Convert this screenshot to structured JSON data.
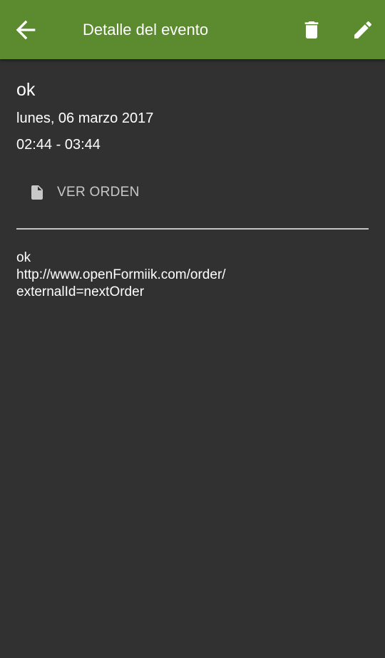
{
  "appbar": {
    "title": "Detalle del evento",
    "back_icon": "arrow-back-icon",
    "delete_icon": "trash-icon",
    "edit_icon": "pencil-icon",
    "color": "#5b8a2f"
  },
  "event": {
    "title": "ok",
    "date": "lunes, 06 marzo 2017",
    "time": "02:44 - 03:44"
  },
  "action": {
    "label": "VER ORDEN",
    "icon": "document-icon"
  },
  "description": {
    "lines": [
      "ok",
      "http://www.openFormiik.com/order/",
      "externalId=nextOrder"
    ]
  },
  "colors": {
    "background": "#313131",
    "text": "#ffffff",
    "secondary_text": "#c8c8c8"
  }
}
